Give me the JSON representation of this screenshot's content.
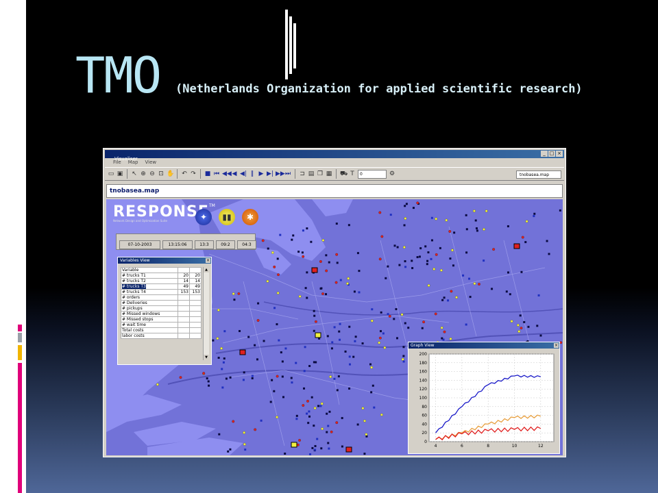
{
  "slide": {
    "title": "TMO",
    "subtitle": "(Netherlands Organization for applied scientific research)",
    "colors": {
      "background": "#000000",
      "title": "#b8e6f4",
      "accent_pink": "#e0007a",
      "accent_yellow": "#f0b400"
    }
  },
  "app": {
    "window_title": "Visualiser",
    "menu": [
      "File",
      "Map",
      "View"
    ],
    "map_name": "tnobasea.map",
    "link_label": "tnobasea.map",
    "toolbar_field": "0",
    "logo_text": "RESPONSE",
    "logo_tm": "TM",
    "logo_tagline": "Network Design and Optimization Suite",
    "status_values": [
      "07-10-2003",
      "13:15:06",
      "13:3",
      "09:2",
      "04:3"
    ],
    "variable_window": {
      "title": "Variables View",
      "header": "Variable",
      "rows": [
        {
          "label": "# trucks T1",
          "a": "20",
          "b": "20"
        },
        {
          "label": "# trucks T2",
          "a": "14",
          "b": "14"
        },
        {
          "label": "# trucks T3",
          "a": "49",
          "b": "49"
        },
        {
          "label": "# trucks T4",
          "a": "153",
          "b": "153"
        },
        {
          "label": "# orders",
          "a": "",
          "b": ""
        },
        {
          "label": "# Deliveries",
          "a": "",
          "b": ""
        },
        {
          "label": "# pickups",
          "a": "",
          "b": ""
        },
        {
          "label": "# Missed windows",
          "a": "",
          "b": ""
        },
        {
          "label": "# Missed stops",
          "a": "",
          "b": ""
        },
        {
          "label": "# wait time",
          "a": "",
          "b": ""
        },
        {
          "label": "Total costs",
          "a": "",
          "b": ""
        },
        {
          "label": "labor costs",
          "a": "",
          "b": ""
        }
      ]
    },
    "graph_window": {
      "title": "Graph View"
    }
  },
  "chart_data": {
    "type": "line",
    "x": [
      4,
      6,
      8,
      10,
      12
    ],
    "xlim": [
      3.5,
      13
    ],
    "ylim": [
      0,
      200
    ],
    "yticks": [
      0,
      20,
      40,
      60,
      80,
      100,
      120,
      140,
      160,
      180,
      200
    ],
    "xticks": [
      4,
      6,
      8,
      10,
      12
    ],
    "grid": true,
    "series": [
      {
        "color": "#1818c8",
        "values": [
          20,
          80,
          130,
          150,
          148
        ]
      },
      {
        "color": "#e8a040",
        "values": [
          5,
          20,
          40,
          55,
          58
        ]
      },
      {
        "color": "#e02020",
        "values": [
          5,
          18,
          25,
          28,
          30
        ]
      }
    ]
  }
}
